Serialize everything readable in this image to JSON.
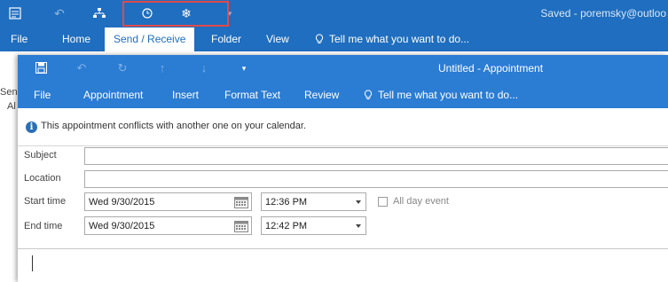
{
  "outlook": {
    "quick_access_icons": [
      "send-receive-all-icon",
      "undo-icon",
      "org-chart-icon",
      "clock-icon",
      "snowflake-icon",
      "customize-icon"
    ],
    "highlight_color": "#e04a4a",
    "status": "Saved - poremsky@outloo",
    "tabs": [
      {
        "label": "File"
      },
      {
        "label": "Home"
      },
      {
        "label": "Send / Receive",
        "active": true
      },
      {
        "label": "Folder"
      },
      {
        "label": "View"
      }
    ],
    "tell_me": "Tell me what you want to do...",
    "left_stub": [
      "Sen",
      "Al"
    ],
    "brand_color": "#1f6ebf"
  },
  "appointment": {
    "window_title": "Untitled  -  Appointment",
    "quick_access_icons": [
      "save-icon",
      "undo-icon",
      "redo-icon",
      "up-arrow-icon",
      "down-arrow-icon",
      "customize-icon"
    ],
    "tabs": [
      "File",
      "Appointment",
      "Insert",
      "Format Text",
      "Review"
    ],
    "tell_me": "Tell me what you want to do...",
    "ribbon_color": "#2b7cd3",
    "conflict_message": "This appointment conflicts with another one on your calendar.",
    "subject_label": "Subject",
    "subject_value": "",
    "location_label": "Location",
    "location_value": "",
    "start_label": "Start time",
    "start_date": "Wed 9/30/2015",
    "start_time": "12:36 PM",
    "all_day_label": "All day event",
    "all_day_checked": false,
    "end_label": "End time",
    "end_date": "Wed 9/30/2015",
    "end_time": "12:42 PM"
  }
}
